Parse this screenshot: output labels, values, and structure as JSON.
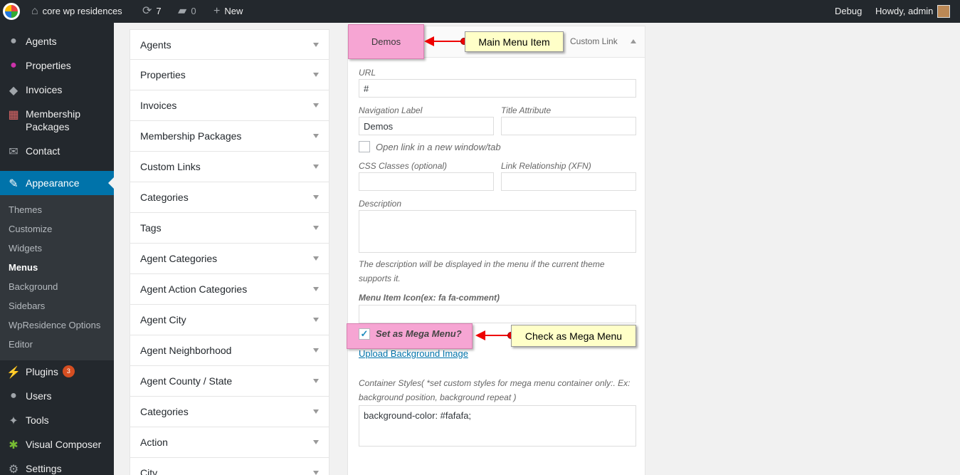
{
  "adminbar": {
    "site_name": "core wp residences",
    "updates_count": "7",
    "comments_count": "0",
    "new_label": "New",
    "debug_label": "Debug",
    "howdy_label": "Howdy, admin"
  },
  "sidebar": {
    "items": [
      {
        "label": "Agents",
        "icon": "agents-icon"
      },
      {
        "label": "Properties",
        "icon": "pin-icon"
      },
      {
        "label": "Invoices",
        "icon": "moneybag-icon"
      },
      {
        "label": "Membership Packages",
        "icon": "calendar-icon"
      },
      {
        "label": "Contact",
        "icon": "envelope-icon"
      },
      {
        "label": "Appearance",
        "icon": "brush-icon"
      },
      {
        "label": "Plugins",
        "icon": "plug-icon"
      },
      {
        "label": "Users",
        "icon": "user-icon"
      },
      {
        "label": "Tools",
        "icon": "wrench-icon"
      },
      {
        "label": "Visual Composer",
        "icon": "composer-icon"
      },
      {
        "label": "Settings",
        "icon": "settings-icon"
      }
    ],
    "membership_line1": "Membership",
    "membership_line2": "Packages",
    "plugins_badge": "3",
    "submenu": [
      "Themes",
      "Customize",
      "Widgets",
      "Menus",
      "Background",
      "Sidebars",
      "WpResidence Options",
      "Editor"
    ]
  },
  "accordion": [
    "Agents",
    "Properties",
    "Invoices",
    "Membership Packages",
    "Custom Links",
    "Categories",
    "Tags",
    "Agent Categories",
    "Agent Action Categories",
    "Agent City",
    "Agent Neighborhood",
    "Agent County / State",
    "Categories",
    "Action",
    "City"
  ],
  "menu_item": {
    "title": "Demos",
    "type": "Custom Link",
    "url_label": "URL",
    "url_value": "#",
    "nav_label_label": "Navigation Label",
    "nav_label_value": "Demos",
    "title_attr_label": "Title Attribute",
    "title_attr_value": "",
    "new_window_label": "Open link in a new window/tab",
    "css_classes_label": "CSS Classes (optional)",
    "xfn_label": "Link Relationship (XFN)",
    "description_label": "Description",
    "description_hint": "The description will be displayed in the menu if the current theme supports it.",
    "icon_label": "Menu Item Icon(ex: fa fa-comment)",
    "mega_menu_label": "Set as Mega Menu?",
    "mega_menu_checked": true,
    "upload_bg_label": "Upload Background Image",
    "container_styles_label": "Container Styles( *set custom styles for mega menu container only:. Ex: background position, background repeat )",
    "container_styles_value": "background-color: #fafafa;"
  },
  "annotations": {
    "main_menu_item": "Main Menu Item",
    "check_mega_menu": "Check as Mega Menu"
  },
  "colors": {
    "adminbar_bg": "#23282d",
    "accent": "#0073aa",
    "callout_bg": "#ffffc8",
    "highlight_pink": "#f6a5d3",
    "arrow_red": "#e00000"
  }
}
